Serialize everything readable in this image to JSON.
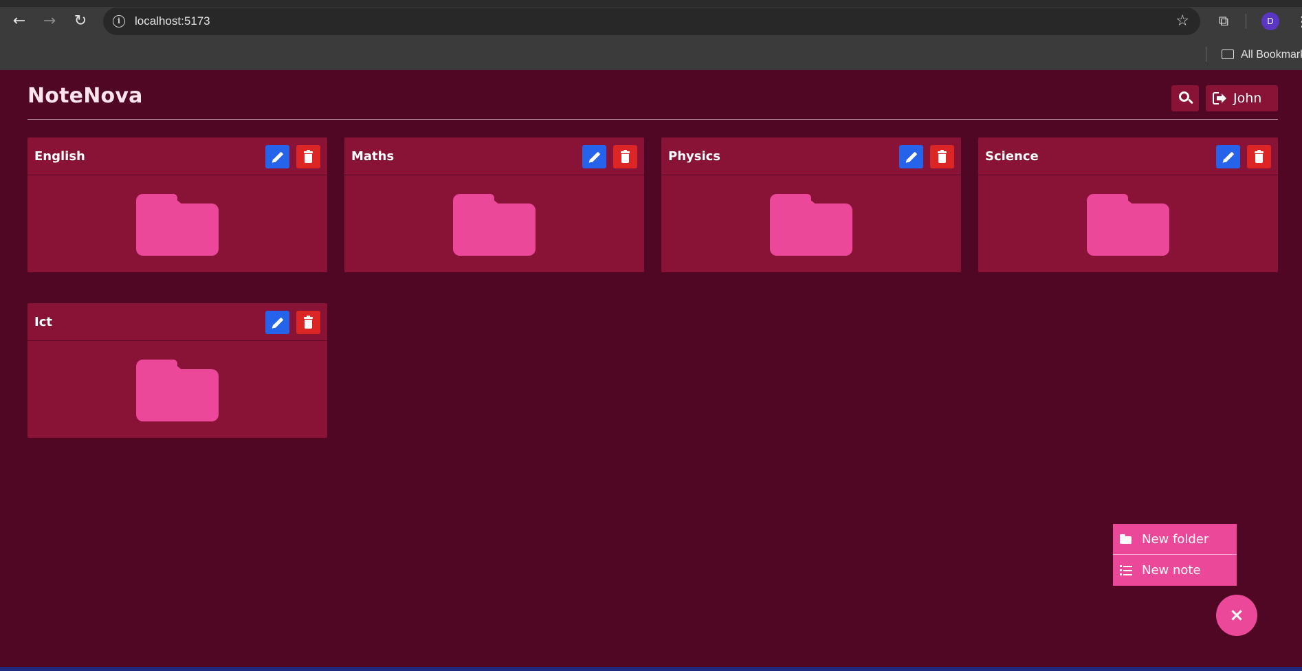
{
  "browser": {
    "url": "localhost:5173",
    "bookmarks_label": "All Bookmarks",
    "profile_initial": "D"
  },
  "app": {
    "brand": "NoteNova",
    "user_name": "John",
    "folders": [
      {
        "name": "English"
      },
      {
        "name": "Maths"
      },
      {
        "name": "Physics"
      },
      {
        "name": "Science"
      },
      {
        "name": "Ict"
      }
    ],
    "fab_menu": {
      "new_folder_label": "New folder",
      "new_note_label": "New note",
      "close_symbol": "×"
    }
  },
  "colors": {
    "background": "#500724",
    "card": "#881337",
    "folder_icon": "#ec4899",
    "edit_button": "#2563eb",
    "delete_button": "#dc2626",
    "fab": "#ec4899"
  }
}
